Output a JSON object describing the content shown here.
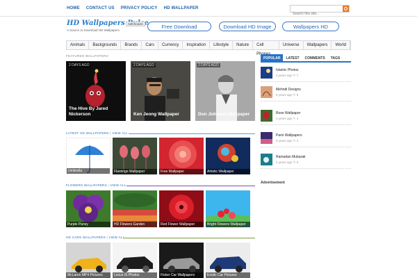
{
  "topnav": [
    "HOME",
    "CONTACT US",
    "PRIVACY POLICY",
    "HD WALLPAPER"
  ],
  "search": {
    "placeholder": "Search this site..."
  },
  "logo": {
    "name": "HD Wallpapers Pulse",
    "tagline": "A Source to Download HD Wallpapers",
    "adchoices": "AdChoices"
  },
  "header_buttons": [
    "Free Download",
    "Download HD Image",
    "Wallpapers HD"
  ],
  "categories": [
    "Animals",
    "Backgrounds",
    "Brands",
    "Cars",
    "Currency",
    "Inspiration",
    "Lifestyle",
    "Nature",
    "Cell Phones",
    "Universe",
    "Wallpapers",
    "World"
  ],
  "featured": {
    "label": "FEATURED WALLPAPERS",
    "items": [
      {
        "badge": "2 DAYS AGO",
        "title": "The Hive By Jared Nickerson"
      },
      {
        "badge": "2 DAYS AGO",
        "title": "Ken Jeong Wallpaper"
      },
      {
        "badge": "2 DAYS AGO",
        "title": "Don Johnson Wallpaper"
      }
    ]
  },
  "latest": {
    "label": "LATEST HD WALLPAPERS",
    "view_all": "VIEW ALL",
    "items": [
      "Umbrella",
      "Flamingo Wallpaper",
      "Free Wallpaper",
      "Artistic Wallpaper"
    ]
  },
  "flowers": {
    "label": "FLOWERS WALLPAPERS",
    "view_all": "VIEW ALL",
    "items": [
      "Purple Pansy",
      "HD Flowers Garden",
      "Red Flower Wallpaper",
      "Bright Flowers Wallpaper"
    ]
  },
  "cars": {
    "label": "HD CARS WALLPAPERS",
    "view_all": "VIEW ALL",
    "items": [
      "McLaren MP4 Pictures",
      "Lexus IS Photos",
      "Fisker Car Wallpapers",
      "Exotic Car Pictures"
    ]
  },
  "sidebar": {
    "tabs": [
      "POPULAR",
      "LATEST",
      "COMMENTS",
      "TAGS"
    ],
    "items": [
      {
        "title": "Islamic Photos",
        "meta": "4 years ago",
        "count": "7"
      },
      {
        "title": "Mehndi Designs",
        "meta": "5 years ago",
        "count": "6"
      },
      {
        "title": "Rose Wallpaper",
        "meta": "4 years ago",
        "count": "4"
      },
      {
        "title": "Paris Wallpapers",
        "meta": "5 years ago",
        "count": "4"
      },
      {
        "title": "Ramadan Mubarak",
        "meta": "4 years ago",
        "count": "0"
      }
    ],
    "advertisement": "Advertisement"
  },
  "colors": {
    "accent": "#2a72c4",
    "latest_rule": "#49a6dd",
    "flowers_rule": "#7a4fb0",
    "cars_rule": "#7a9c35"
  }
}
